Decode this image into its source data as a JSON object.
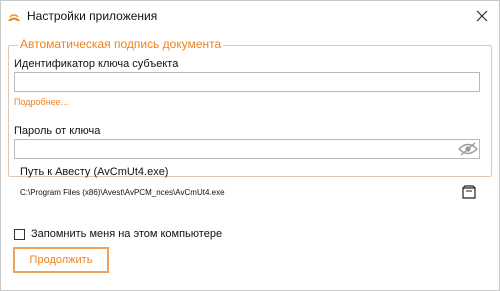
{
  "window": {
    "title": "Настройки приложения",
    "logo_icon": "app-logo-icon",
    "close_icon": "close-icon"
  },
  "group": {
    "title": "Автоматическая подпись документа"
  },
  "key_id": {
    "label": "Идентификатор ключа субъекта",
    "value": "",
    "more_link": "Подробнее..."
  },
  "password": {
    "label": "Пароль от ключа",
    "value": "",
    "toggle_icon": "eye-icon"
  },
  "avest_path": {
    "label": "Путь к Авесту (AvCmUt4.exe)",
    "value": "C:\\Program Files (x86)\\Avest\\AvPCM_nces\\AvCmUt4.exe",
    "browse_icon": "folder-open-icon"
  },
  "remember": {
    "label": "Запомнить меня на этом компьютере",
    "checked": false
  },
  "actions": {
    "continue_label": "Продолжить"
  },
  "colors": {
    "accent": "#f0821e",
    "accent_border": "#f0a25a"
  }
}
